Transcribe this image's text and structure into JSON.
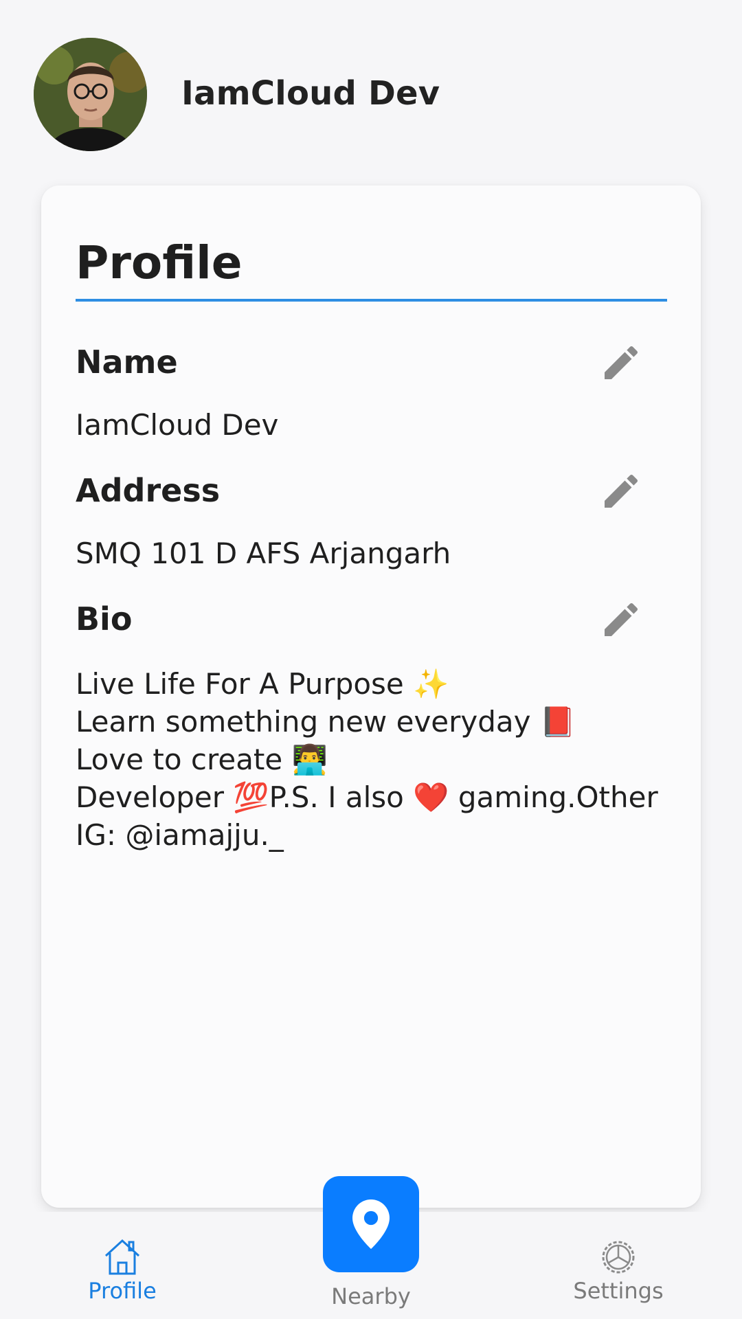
{
  "header": {
    "avatar_icon": "user-photo",
    "username": "IamCloud Dev"
  },
  "card": {
    "title": "Profile",
    "fields": [
      {
        "label": "Name",
        "value": "IamCloud Dev",
        "edit_icon": "pencil-icon"
      },
      {
        "label": "Address",
        "value": "SMQ 101 D AFS Arjangarh",
        "edit_icon": "pencil-icon"
      },
      {
        "label": "Bio",
        "value": "Live Life For A Purpose ✨\nLearn something new everyday 📕\nLove to create 👨‍💻\nDeveloper 💯P.S. I also ❤️ gaming.Other IG: @iamajju._",
        "edit_icon": "pencil-icon"
      }
    ]
  },
  "nav": {
    "items": [
      {
        "label": "Profile",
        "icon": "home-icon",
        "active": true
      },
      {
        "label": "Nearby",
        "icon": "location-pin-icon",
        "active": false
      },
      {
        "label": "Settings",
        "icon": "gear-icon",
        "active": false
      }
    ]
  },
  "colors": {
    "accent": "#1a7fe0",
    "nearby_button": "#0a7dff",
    "rule": "#2e8ee3",
    "inactive": "#7a7a7a"
  }
}
